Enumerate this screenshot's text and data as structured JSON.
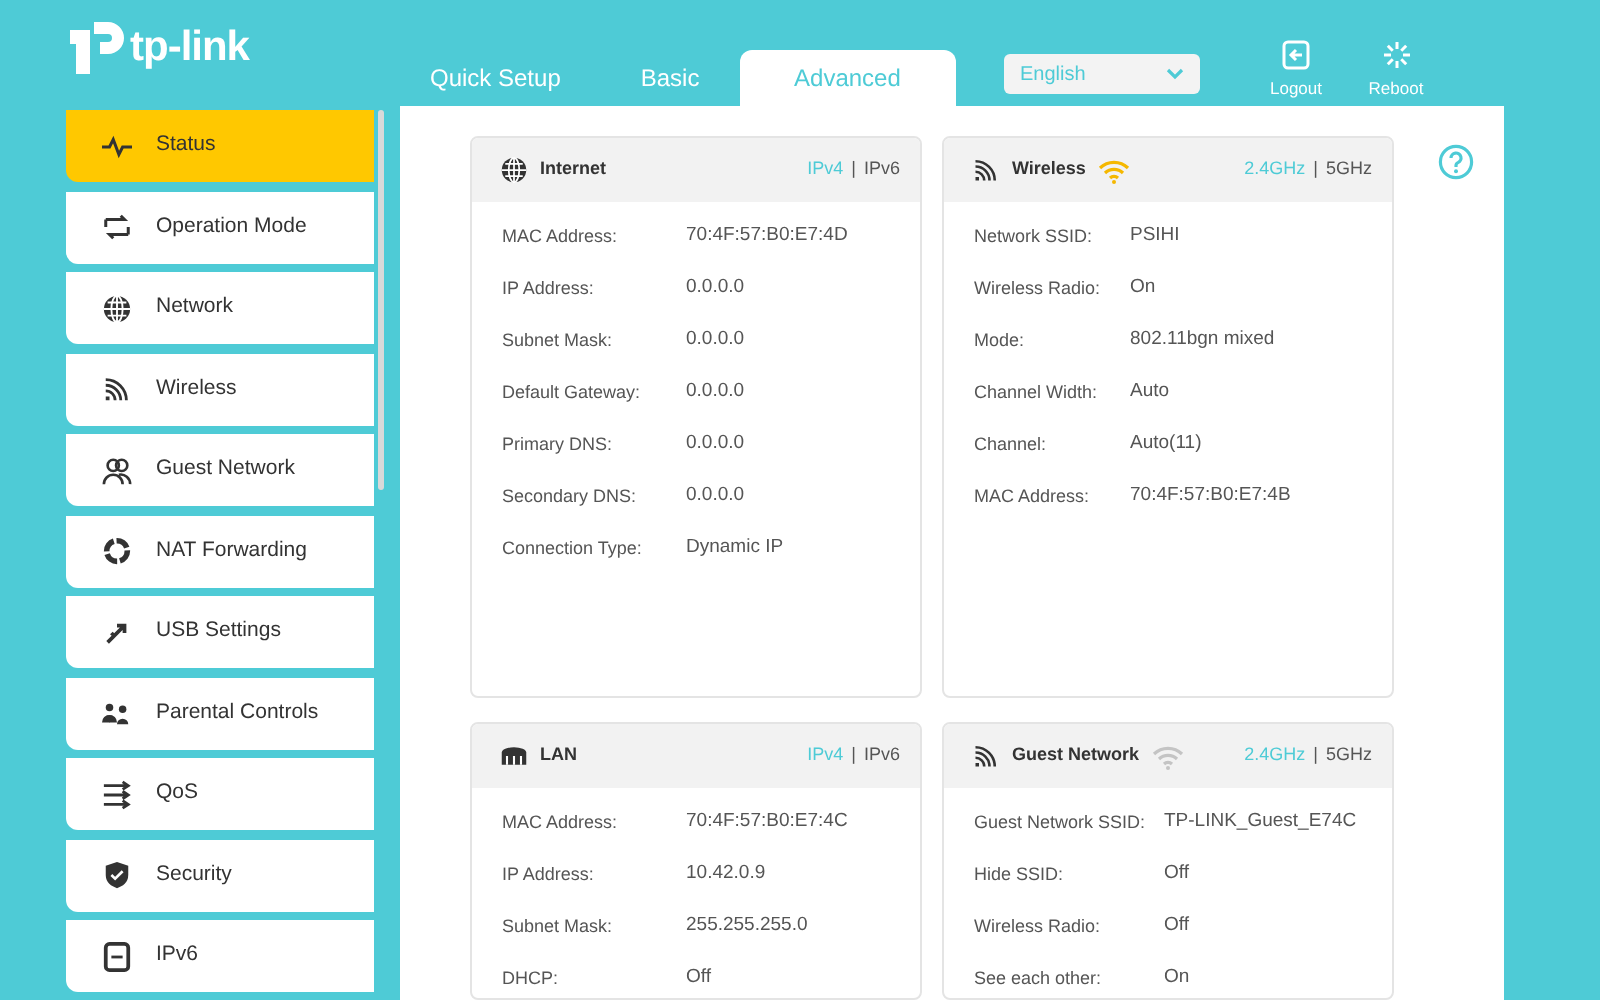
{
  "header": {
    "logo": "tp-link",
    "tabs": [
      {
        "label": "Quick Setup",
        "selected": false
      },
      {
        "label": "Basic",
        "selected": false
      },
      {
        "label": "Advanced",
        "selected": true
      }
    ],
    "language": "English",
    "actions": [
      {
        "kind": "logout",
        "label": "Logout"
      },
      {
        "kind": "reboot",
        "label": "Reboot"
      }
    ]
  },
  "sidebar": {
    "items": [
      {
        "label": "Status",
        "selected": true
      },
      {
        "label": "Operation Mode",
        "selected": false
      },
      {
        "label": "Network",
        "selected": false
      },
      {
        "label": "Wireless",
        "selected": false
      },
      {
        "label": "Guest Network",
        "selected": false
      },
      {
        "label": "NAT Forwarding",
        "selected": false
      },
      {
        "label": "USB Settings",
        "selected": false
      },
      {
        "label": "Parental Controls",
        "selected": false
      },
      {
        "label": "QoS",
        "selected": false
      },
      {
        "label": "Security",
        "selected": false
      },
      {
        "label": "IPv6",
        "selected": false
      }
    ]
  },
  "cards": [
    {
      "title": "Internet",
      "separator": "|",
      "options": [
        {
          "label": "IPv4",
          "selected": true
        },
        {
          "label": "IPv6",
          "selected": false
        }
      ],
      "rows": [
        {
          "label": "MAC Address:",
          "value": "70:4F:57:B0:E7:4D"
        },
        {
          "label": "IP Address:",
          "value": "0.0.0.0"
        },
        {
          "label": "Subnet Mask:",
          "value": "0.0.0.0"
        },
        {
          "label": "Default Gateway:",
          "value": "0.0.0.0"
        },
        {
          "label": "Primary DNS:",
          "value": "0.0.0.0"
        },
        {
          "label": "Secondary DNS:",
          "value": "0.0.0.0"
        },
        {
          "label": "Connection Type:",
          "value": "Dynamic IP"
        }
      ]
    },
    {
      "title": "Wireless",
      "separator": "|",
      "wifi_enabled": true,
      "options": [
        {
          "label": "2.4GHz",
          "selected": true
        },
        {
          "label": "5GHz",
          "selected": false
        }
      ],
      "rows": [
        {
          "label": "Network SSID:",
          "value": "PSIHI"
        },
        {
          "label": "Wireless Radio:",
          "value": "On"
        },
        {
          "label": "Mode:",
          "value": "802.11bgn mixed"
        },
        {
          "label": "Channel Width:",
          "value": "Auto"
        },
        {
          "label": "Channel:",
          "value": "Auto(11)"
        },
        {
          "label": "MAC Address:",
          "value": "70:4F:57:B0:E7:4B"
        }
      ]
    },
    {
      "title": "LAN",
      "separator": "|",
      "options": [
        {
          "label": "IPv4",
          "selected": true
        },
        {
          "label": "IPv6",
          "selected": false
        }
      ],
      "rows": [
        {
          "label": "MAC Address:",
          "value": "70:4F:57:B0:E7:4C"
        },
        {
          "label": "IP Address:",
          "value": "10.42.0.9"
        },
        {
          "label": "Subnet Mask:",
          "value": "255.255.255.0"
        },
        {
          "label": "DHCP:",
          "value": "Off"
        }
      ]
    },
    {
      "title": "Guest Network",
      "separator": "|",
      "wifi_enabled": false,
      "options": [
        {
          "label": "2.4GHz",
          "selected": true
        },
        {
          "label": "5GHz",
          "selected": false
        }
      ],
      "rows": [
        {
          "label": "Guest Network SSID:",
          "value": "TP-LINK_Guest_E74C"
        },
        {
          "label": "Hide SSID:",
          "value": "Off"
        },
        {
          "label": "Wireless Radio:",
          "value": "Off"
        },
        {
          "label": "See each other:",
          "value": "On"
        }
      ]
    }
  ]
}
